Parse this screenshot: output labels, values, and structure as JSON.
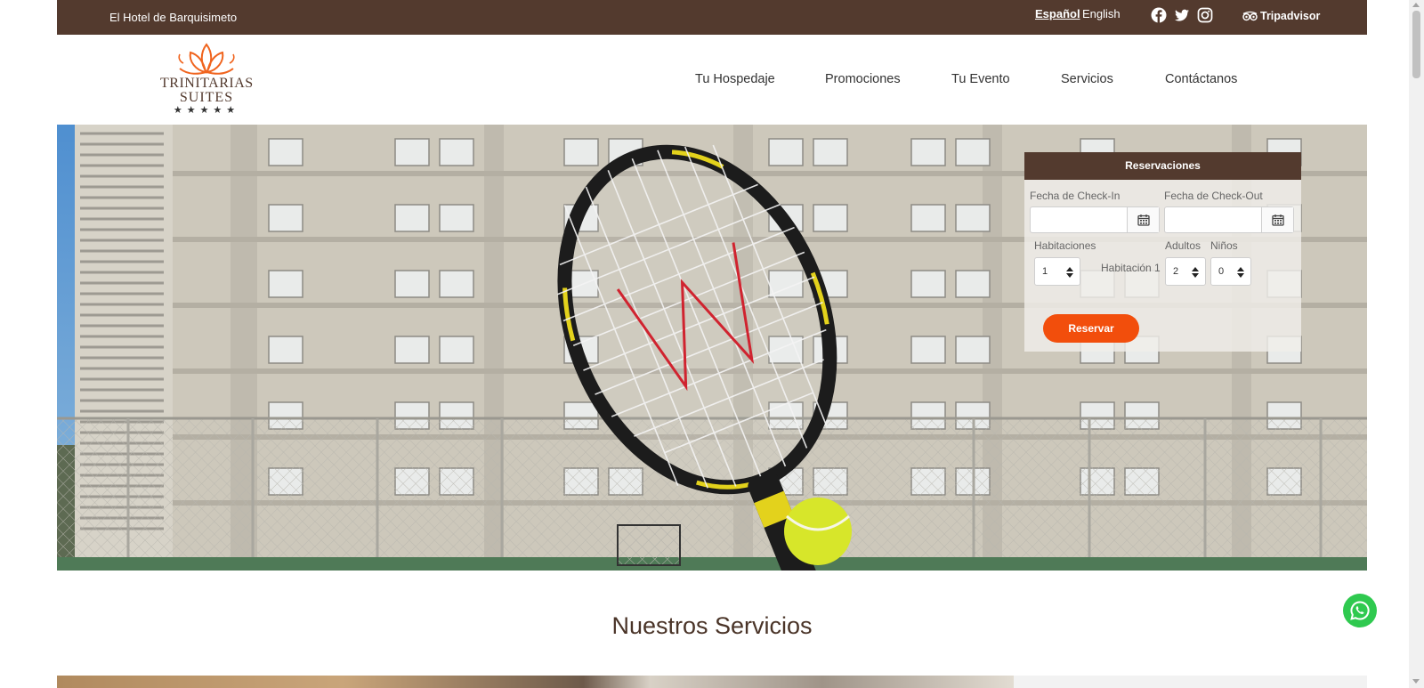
{
  "topbar": {
    "tagline": "El Hotel de Barquisimeto",
    "lang_es": "Español",
    "lang_en": "English",
    "social_icons": [
      "facebook-icon",
      "twitter-icon",
      "instagram-icon"
    ],
    "tripadvisor": "Tripadvisor"
  },
  "logo": {
    "line1": "Trinitarias",
    "line2": "Suites",
    "stars": "★★★★★",
    "stars_count": 5
  },
  "nav": {
    "items": [
      "Tu Hospedaje",
      "Promociones",
      "Tu Evento",
      "Servicios",
      "Contáctanos"
    ]
  },
  "reservations": {
    "title": "Reservaciones",
    "checkin_label": "Fecha de Check-In",
    "checkout_label": "Fecha de Check-Out",
    "checkin_value": "",
    "checkout_value": "",
    "rooms_label": "Habitaciones",
    "rooms_value": "1",
    "room_label": "Habitación 1",
    "adults_label": "Adultos",
    "adults_value": "2",
    "children_label": "Niños",
    "children_value": "0",
    "submit": "Reservar"
  },
  "section": {
    "title": "Nuestros Servicios"
  },
  "colors": {
    "brand_brown": "#533a2e",
    "accent_orange": "#f24e0c",
    "whatsapp_green": "#2fc94f"
  }
}
